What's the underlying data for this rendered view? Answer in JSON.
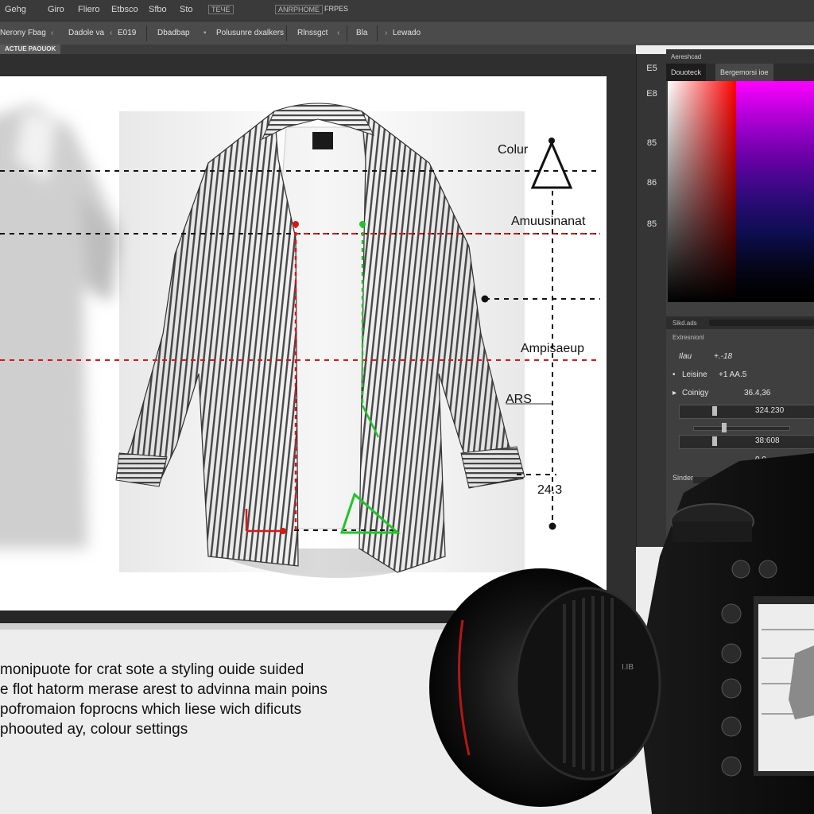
{
  "menubar": {
    "items": [
      "Gehg",
      "Giro",
      "Fliero",
      "Etbsco",
      "Sfbo",
      "Sto"
    ],
    "boxed_items": [
      "ТЕЧЕ",
      "ANRPHOME",
      "FRPES"
    ]
  },
  "optionsbar": {
    "items": [
      "Nerony Fbag",
      "Dadole va",
      "E019",
      "Dbadbap",
      "Polusunre dxalkers",
      "Rlnssgct",
      "Bla",
      "Lewado"
    ]
  },
  "document": {
    "tab_label": "ACTUE PAOUOK"
  },
  "toolstrip": {
    "tools": [
      "E5",
      "E8",
      "85",
      "86",
      "85"
    ]
  },
  "panel": {
    "header": "Aereshcad",
    "tab_a": "Douoteck",
    "tab_b": "Bergemorsi ioe",
    "layers_label": "Sikd.ads",
    "properties_title": "Extresnionl",
    "rows": [
      {
        "label": "Ilau",
        "value": "+.-18"
      },
      {
        "label": "Leisine",
        "value": "+1 AA.5"
      },
      {
        "label": "Coinigy",
        "value": "36.4,36"
      },
      {
        "label": "",
        "value": "324.230"
      },
      {
        "label": "",
        "value": "38:608"
      },
      {
        "label": "",
        "value": "0.0"
      }
    ],
    "slider_label": "Sinder"
  },
  "guide": {
    "labels": [
      "Colur",
      "Amuusinanat",
      "Ampisaeup",
      "ARS",
      "24.3"
    ],
    "colors": {
      "black": "#111111",
      "red": "#d81818",
      "green": "#22c42c"
    }
  },
  "caption": {
    "lines": [
      "monipuote for crat sote a styling ouide suided",
      "e flot hatorm merase  arest to  advinna main poins",
      "pofromaion  foprocns which liese wich dificuts",
      "phoouted ay, colour settings"
    ]
  },
  "camera": {
    "lens_marking": "I.IB"
  }
}
